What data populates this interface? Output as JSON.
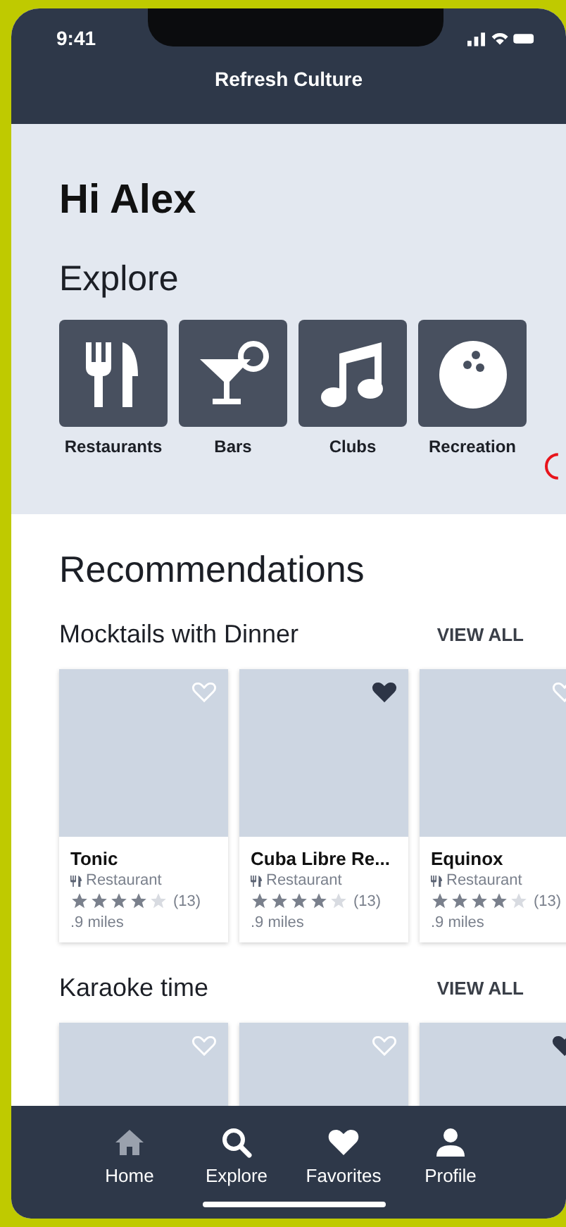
{
  "status_bar": {
    "time": "9:41"
  },
  "header": {
    "title": "Refresh Culture"
  },
  "greeting": "Hi Alex",
  "explore": {
    "title": "Explore",
    "categories": [
      {
        "label": "Restaurants",
        "kind": "dining"
      },
      {
        "label": "Bars",
        "kind": "cocktail"
      },
      {
        "label": "Clubs",
        "kind": "music"
      },
      {
        "label": "Recreation",
        "kind": "bowling"
      }
    ]
  },
  "recommendations": {
    "title": "Recommendations",
    "sections": [
      {
        "title": "Mocktails with Dinner",
        "action": "VIEW ALL",
        "cards": [
          {
            "name": "Tonic",
            "category": "Restaurant",
            "stars": 4,
            "count": "(13)",
            "distance": ".9 miles",
            "favorite": false
          },
          {
            "name": "Cuba Libre Re...",
            "category": "Restaurant",
            "stars": 4,
            "count": "(13)",
            "distance": ".9 miles",
            "favorite": true
          },
          {
            "name": "Equinox",
            "category": "Restaurant",
            "stars": 4,
            "count": "(13)",
            "distance": ".9 miles",
            "favorite": false
          }
        ]
      },
      {
        "title": "Karaoke time",
        "action": "VIEW ALL",
        "cards": [
          {
            "favorite": false
          },
          {
            "favorite": false
          },
          {
            "favorite": true
          }
        ]
      }
    ]
  },
  "tab_bar": [
    {
      "label": "Home",
      "kind": "home",
      "dimmed": true
    },
    {
      "label": "Explore",
      "kind": "search",
      "dimmed": false
    },
    {
      "label": "Favorites",
      "kind": "heart",
      "dimmed": false
    },
    {
      "label": "Profile",
      "kind": "person",
      "dimmed": false
    }
  ]
}
